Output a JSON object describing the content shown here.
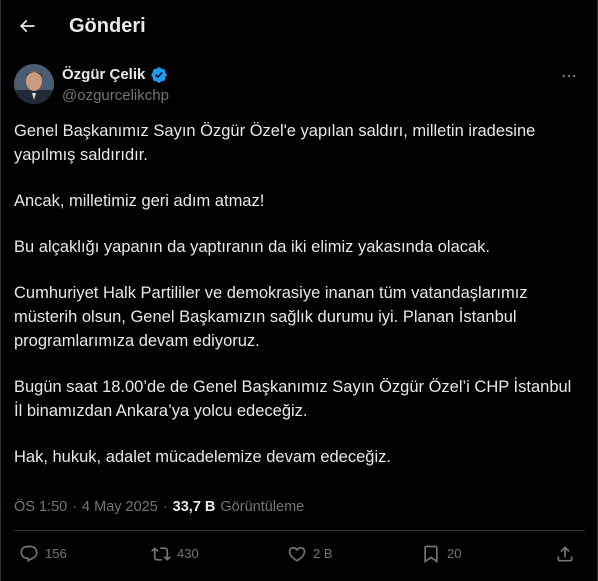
{
  "header": {
    "back_icon": "arrow-left-icon",
    "title": "Gönderi"
  },
  "author": {
    "name": "Özgür Çelik",
    "handle": "@ozgurcelikchp",
    "verified": true,
    "verified_color": "#1d9bf0"
  },
  "tweet": {
    "paragraphs": [
      "Genel Başkanımız Sayın Özgür Özel'e yapılan saldırı, milletin iradesine yapılmış saldırıdır.",
      "Ancak, milletimiz geri adım atmaz!",
      "Bu alçaklığı yapanın da yaptıranın da iki elimiz yakasında olacak.",
      "Cumhuriyet Halk Partililer ve demokrasiye inanan tüm vatandaşlarımız müsterih olsun, Genel Başkamızın sağlık durumu iyi. Planan İstanbul programlarımıza devam ediyoruz.",
      "Bugün saat 18.00’de de Genel Başkanımız Sayın Özgür Özel’i CHP İstanbul İl binamızdan Ankara’ya yolcu edeceğiz.",
      "Hak, hukuk, adalet mücadelemize devam edeceğiz."
    ]
  },
  "meta": {
    "time": "ÖS 1:50",
    "separator": "·",
    "date": "4 May 2025",
    "views_count": "33,7 B",
    "views_label": "Görüntüleme"
  },
  "actions": {
    "replies": "156",
    "reposts": "430",
    "likes": "2 B",
    "bookmarks": "20"
  },
  "colors": {
    "background": "#000000",
    "text_primary": "#e7e9ea",
    "text_secondary": "#71767b",
    "border": "#2f3336"
  }
}
